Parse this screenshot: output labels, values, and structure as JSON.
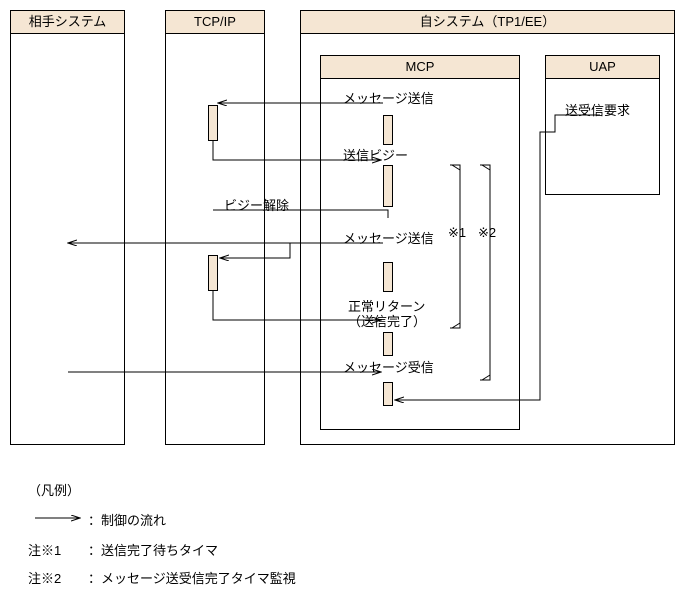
{
  "participants": {
    "remote": "相手システム",
    "tcpip": "TCP/IP",
    "self_system": "自システム（TP1/EE）",
    "mcp": "MCP",
    "uap": "UAP"
  },
  "messages": {
    "msg_send_1": "メッセージ送信",
    "send_recv_req": "送受信要求",
    "send_busy": "送信ビジー",
    "busy_clear": "ビジー解除",
    "msg_send_2": "メッセージ送信",
    "normal_return_1": "正常リターン",
    "normal_return_2": "（送信完了）",
    "msg_recv": "メッセージ受信"
  },
  "notes": {
    "n1": "※1",
    "n2": "※2"
  },
  "legend": {
    "title": "（凡例）",
    "arrow_label": "：制御の流れ",
    "note1_key": "注※1",
    "note1_val": "：送信完了待ちタイマ",
    "note2_key": "注※2",
    "note2_val": "：メッセージ送受信完了タイマ監視"
  }
}
